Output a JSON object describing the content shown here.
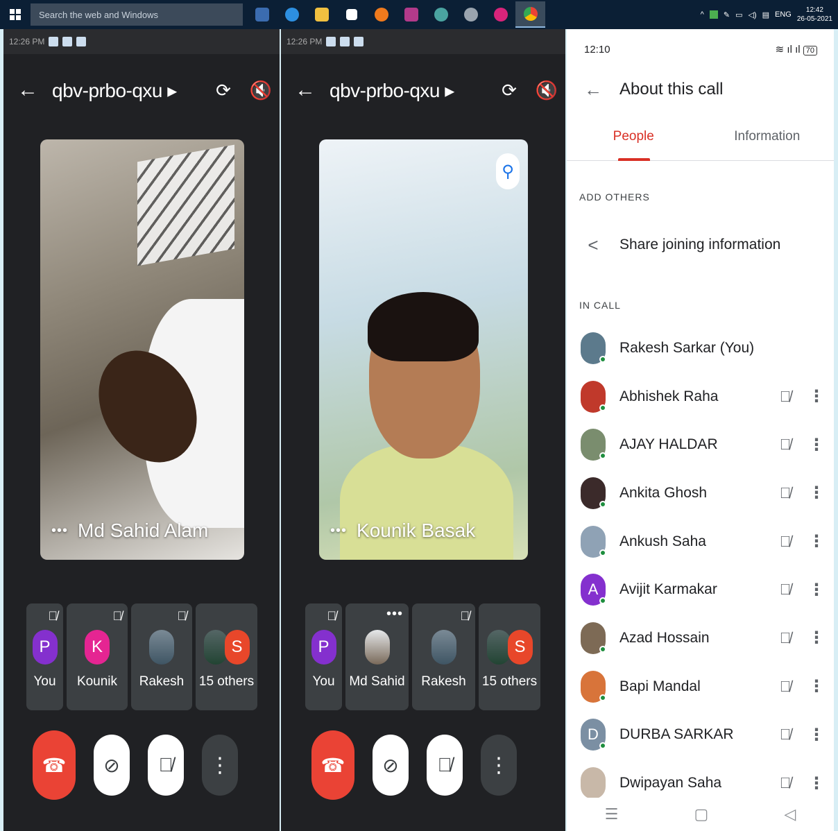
{
  "taskbar": {
    "search_placeholder": "Search the web and Windows",
    "tray_lang": "ENG",
    "clock_time": "12:42",
    "clock_date": "26-05-2021"
  },
  "meet_left": {
    "status": "12:26 PM",
    "meeting_code": "qbv-prbo-qxu ▸",
    "tile_name": "Md Sahid Alam",
    "thumbs": [
      {
        "label": "You",
        "letter": "P",
        "color": "#8430ce"
      },
      {
        "label": "Kounik",
        "letter": "K",
        "color": "#e52592"
      },
      {
        "label": "Rakesh",
        "letter": "",
        "color": "#6a7e8a"
      },
      {
        "label": "15 others",
        "letter": "S",
        "color": "#e8472a"
      }
    ]
  },
  "meet_right": {
    "status": "12:26 PM",
    "meeting_code": "qbv-prbo-qxu ▸",
    "tile_name": "Kounik Basak",
    "thumbs": [
      {
        "label": "You",
        "letter": "P",
        "color": "#8430ce"
      },
      {
        "label": "Md Sahid",
        "letter": "",
        "color": "#d5dbe0"
      },
      {
        "label": "Rakesh",
        "letter": "",
        "color": "#6a7e8a"
      },
      {
        "label": "15 others",
        "letter": "S",
        "color": "#e8472a"
      }
    ]
  },
  "side": {
    "phone_time": "12:10",
    "battery": "70",
    "title": "About this call",
    "tabs": [
      "People",
      "Information"
    ],
    "add_others": "ADD OTHERS",
    "share": "Share joining information",
    "in_call": "IN CALL",
    "people": [
      {
        "name": "Rakesh Sarkar (You)",
        "letter": "",
        "color": "#5c7a8c",
        "muted": false
      },
      {
        "name": "Abhishek Raha",
        "letter": "",
        "color": "#c0392b",
        "muted": true
      },
      {
        "name": "AJAY HALDAR",
        "letter": "",
        "color": "#7a8d6e",
        "muted": true
      },
      {
        "name": "Ankita Ghosh",
        "letter": "",
        "color": "#3b2a2a",
        "muted": true
      },
      {
        "name": "Ankush Saha",
        "letter": "",
        "color": "#8fa2b5",
        "muted": true
      },
      {
        "name": "Avijit Karmakar",
        "letter": "A",
        "color": "#8430ce",
        "muted": true
      },
      {
        "name": "Azad Hossain",
        "letter": "",
        "color": "#7d6a55",
        "muted": true
      },
      {
        "name": "Bapi Mandal",
        "letter": "",
        "color": "#d8743a",
        "muted": true
      },
      {
        "name": "DURBA SARKAR",
        "letter": "D",
        "color": "#7b8fa3",
        "muted": true
      },
      {
        "name": "Dwipayan Saha",
        "letter": "",
        "color": "#c8b8a8",
        "muted": true
      }
    ]
  }
}
